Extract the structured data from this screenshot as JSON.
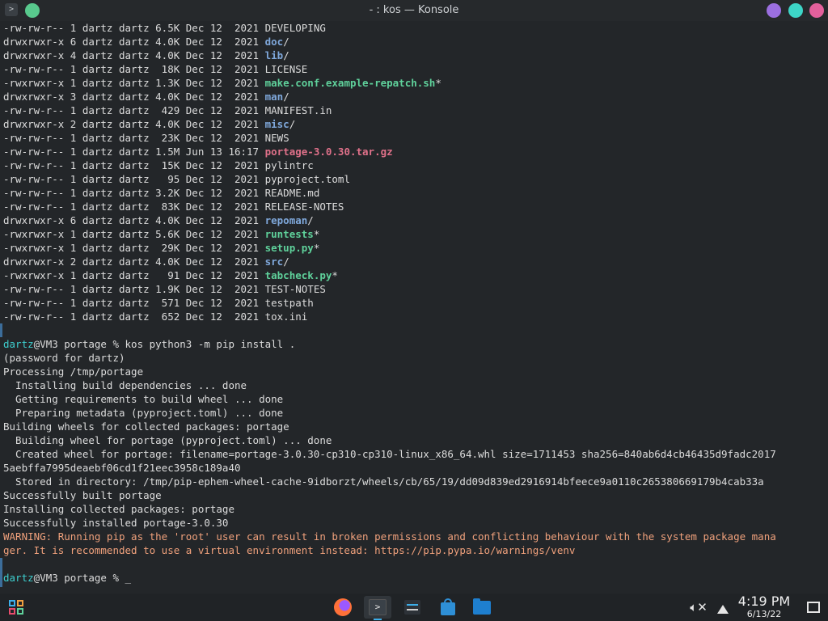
{
  "window": {
    "title": "- : kos — Konsole"
  },
  "terminal": {
    "listing": [
      {
        "meta": "-rw-rw-r-- 1 dartz dartz 6.5K Dec 12  2021 ",
        "name": "DEVELOPING",
        "kind": "file"
      },
      {
        "meta": "drwxrwxr-x 6 dartz dartz 4.0K Dec 12  2021 ",
        "name": "doc",
        "suffix": "/",
        "kind": "dir"
      },
      {
        "meta": "drwxrwxr-x 4 dartz dartz 4.0K Dec 12  2021 ",
        "name": "lib",
        "suffix": "/",
        "kind": "dir"
      },
      {
        "meta": "-rw-rw-r-- 1 dartz dartz  18K Dec 12  2021 ",
        "name": "LICENSE",
        "kind": "file"
      },
      {
        "meta": "-rwxrwxr-x 1 dartz dartz 1.3K Dec 12  2021 ",
        "name": "make.conf.example-repatch.sh",
        "suffix": "*",
        "kind": "exec"
      },
      {
        "meta": "drwxrwxr-x 3 dartz dartz 4.0K Dec 12  2021 ",
        "name": "man",
        "suffix": "/",
        "kind": "dir"
      },
      {
        "meta": "-rw-rw-r-- 1 dartz dartz  429 Dec 12  2021 ",
        "name": "MANIFEST.in",
        "kind": "file"
      },
      {
        "meta": "drwxrwxr-x 2 dartz dartz 4.0K Dec 12  2021 ",
        "name": "misc",
        "suffix": "/",
        "kind": "dir"
      },
      {
        "meta": "-rw-rw-r-- 1 dartz dartz  23K Dec 12  2021 ",
        "name": "NEWS",
        "kind": "file"
      },
      {
        "meta": "-rw-rw-r-- 1 dartz dartz 1.5M Jun 13 16:17 ",
        "name": "portage-3.0.30.tar.gz",
        "kind": "arch"
      },
      {
        "meta": "-rw-rw-r-- 1 dartz dartz  15K Dec 12  2021 ",
        "name": "pylintrc",
        "kind": "file"
      },
      {
        "meta": "-rw-rw-r-- 1 dartz dartz   95 Dec 12  2021 ",
        "name": "pyproject.toml",
        "kind": "file"
      },
      {
        "meta": "-rw-rw-r-- 1 dartz dartz 3.2K Dec 12  2021 ",
        "name": "README.md",
        "kind": "file"
      },
      {
        "meta": "-rw-rw-r-- 1 dartz dartz  83K Dec 12  2021 ",
        "name": "RELEASE-NOTES",
        "kind": "file"
      },
      {
        "meta": "drwxrwxr-x 6 dartz dartz 4.0K Dec 12  2021 ",
        "name": "repoman",
        "suffix": "/",
        "kind": "dir"
      },
      {
        "meta": "-rwxrwxr-x 1 dartz dartz 5.6K Dec 12  2021 ",
        "name": "runtests",
        "suffix": "*",
        "kind": "exec"
      },
      {
        "meta": "-rwxrwxr-x 1 dartz dartz  29K Dec 12  2021 ",
        "name": "setup.py",
        "suffix": "*",
        "kind": "exec"
      },
      {
        "meta": "drwxrwxr-x 2 dartz dartz 4.0K Dec 12  2021 ",
        "name": "src",
        "suffix": "/",
        "kind": "dir"
      },
      {
        "meta": "-rwxrwxr-x 1 dartz dartz   91 Dec 12  2021 ",
        "name": "tabcheck.py",
        "suffix": "*",
        "kind": "exec"
      },
      {
        "meta": "-rw-rw-r-- 1 dartz dartz 1.9K Dec 12  2021 ",
        "name": "TEST-NOTES",
        "kind": "file"
      },
      {
        "meta": "-rw-rw-r-- 1 dartz dartz  571 Dec 12  2021 ",
        "name": "testpath",
        "kind": "file"
      },
      {
        "meta": "-rw-rw-r-- 1 dartz dartz  652 Dec 12  2021 ",
        "name": "tox.ini",
        "kind": "file"
      }
    ],
    "prompt_user": "dartz",
    "prompt_host": "@VM3 portage % ",
    "command": "kos python3 -m pip install .",
    "output": [
      "(password for dartz)",
      "Processing /tmp/portage",
      "  Installing build dependencies ... done",
      "  Getting requirements to build wheel ... done",
      "  Preparing metadata (pyproject.toml) ... done",
      "Building wheels for collected packages: portage",
      "  Building wheel for portage (pyproject.toml) ... done",
      "  Created wheel for portage: filename=portage-3.0.30-cp310-cp310-linux_x86_64.whl size=1711453 sha256=840ab6d4cb46435d9fadc2017",
      "5aebffa7995deaebf06cd1f21eec3958c189a40",
      "  Stored in directory: /tmp/pip-ephem-wheel-cache-9idborzt/wheels/cb/65/19/dd09d839ed2916914bfeece9a0110c265380669179b4cab33a",
      "Successfully built portage",
      "Installing collected packages: portage",
      "Successfully installed portage-3.0.30"
    ],
    "warning": [
      "WARNING: Running pip as the 'root' user can result in broken permissions and conflicting behaviour with the system package mana",
      "ger. It is recommended to use a virtual environment instead: https://pip.pypa.io/warnings/venv"
    ],
    "cursor": "_"
  },
  "taskbar": {
    "clock_time": "4:19 PM",
    "clock_date": "6/13/22",
    "konsole_glyph": ">",
    "volume_glyph": "🔇"
  },
  "colors": {
    "directory": "#7fa8db",
    "executable": "#5fd19b",
    "archive": "#e0718a",
    "prompt_user": "#3ecfcf",
    "warning": "#f0a17c",
    "accent": "#3daee9"
  }
}
